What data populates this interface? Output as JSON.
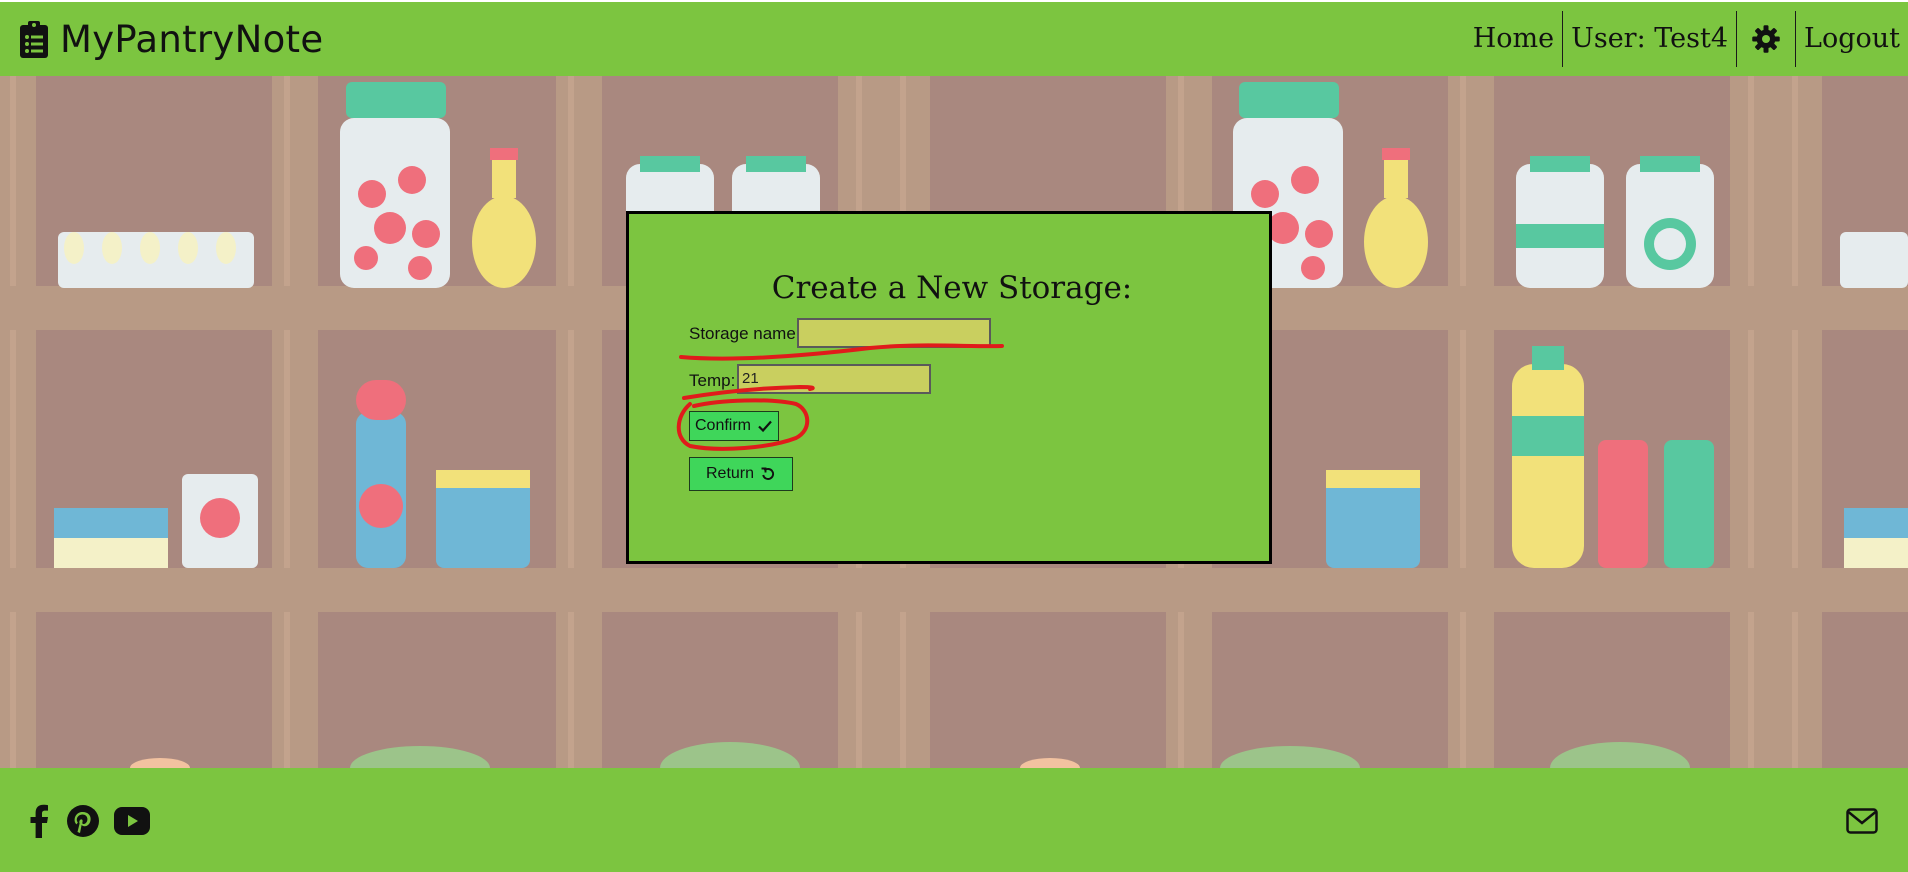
{
  "app": {
    "brand": "MyPantryNote",
    "icon": "clipboard-list-icon"
  },
  "nav": {
    "home": "Home",
    "user": "User: Test4",
    "settings_icon": "gear-icon",
    "logout": "Logout"
  },
  "dialog": {
    "title": "Create a New Storage:",
    "storage_name_label": "Storage name:",
    "storage_name_value": "",
    "temp_label": "Temp:",
    "temp_value": "21",
    "confirm_label": "Confirm",
    "confirm_icon": "check-icon",
    "return_label": "Return",
    "return_icon": "undo-icon"
  },
  "footer": {
    "social_icons": [
      "facebook-icon",
      "pinterest-icon",
      "youtube-icon"
    ],
    "contact_icon": "envelope-icon"
  },
  "colors": {
    "brand_green": "#7cc540",
    "button_green": "#3fd65a",
    "field_yellow": "#c9cf5f",
    "annotation_red": "#e01b1b",
    "pantry_wall": "#a9887f",
    "shelf": "#b89a85"
  }
}
